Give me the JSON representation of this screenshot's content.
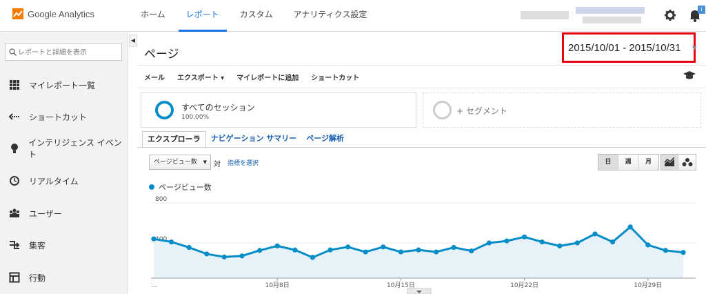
{
  "app": {
    "name": "Google Analytics"
  },
  "nav": {
    "items": [
      "ホーム",
      "レポート",
      "カスタム",
      "アナリティクス設定"
    ],
    "active": 1
  },
  "header": {
    "notification_badge": "i"
  },
  "sidebar": {
    "search_placeholder": "レポートと詳細を表示",
    "items": [
      {
        "label": "マイレポート一覧",
        "icon": "grid-icon"
      },
      {
        "label": "ショートカット",
        "icon": "shortcut-icon"
      },
      {
        "label": "インテリジェンス イベント",
        "icon": "lightbulb-icon"
      },
      {
        "label": "リアルタイム",
        "icon": "clock-icon"
      },
      {
        "label": "ユーザー",
        "icon": "users-icon"
      },
      {
        "label": "集客",
        "icon": "acquisition-icon"
      },
      {
        "label": "行動",
        "icon": "behavior-icon"
      }
    ],
    "collapse_glyph": "◀"
  },
  "page": {
    "title": "ページ",
    "date_range": "2015/10/01 - 2015/10/31"
  },
  "toolbar": {
    "mail": "メール",
    "export": "エクスポート ▾",
    "add_dashboard": "マイレポートに追加",
    "shortcut": "ショートカット"
  },
  "segments": {
    "all_sessions": "すべてのセッション",
    "all_sessions_pct": "100.00%",
    "add_segment": "+ セグメント"
  },
  "tabs": [
    "エクスプローラ",
    "ナビゲーション サマリー",
    "ページ解析"
  ],
  "controls": {
    "metric": "ページビュー数",
    "vs": "対",
    "choose_metric": "指標を選択",
    "period": [
      "日",
      "週",
      "月"
    ]
  },
  "colors": {
    "accent": "#058dc7",
    "fill": "#e6f2f8",
    "highlight": "#e60012"
  },
  "chart_data": {
    "type": "area",
    "series": [
      {
        "name": "ページビュー数",
        "values": [
          440,
          410,
          355,
          290,
          260,
          270,
          325,
          370,
          330,
          255,
          330,
          360,
          310,
          360,
          310,
          330,
          310,
          355,
          320,
          400,
          420,
          460,
          410,
          370,
          400,
          490,
          410,
          560,
          380,
          325,
          305
        ]
      }
    ],
    "x": [
      "...",
      "10月2日",
      "10月3日",
      "10月4日",
      "10月5日",
      "10月6日",
      "10月7日",
      "10月8日",
      "10月9日",
      "10月10日",
      "10月11日",
      "10月12日",
      "10月13日",
      "10月14日",
      "10月15日",
      "10月16日",
      "10月17日",
      "10月18日",
      "10月19日",
      "10月20日",
      "10月21日",
      "10月22日",
      "10月23日",
      "10月24日",
      "10月25日",
      "10月26日",
      "10月27日",
      "10月28日",
      "10月29日",
      "10月30日",
      "10月31日"
    ],
    "tick_labels": [
      {
        "index": 0,
        "label": "..."
      },
      {
        "index": 7,
        "label": "10月8日"
      },
      {
        "index": 14,
        "label": "10月15日"
      },
      {
        "index": 21,
        "label": "10月22日"
      },
      {
        "index": 28,
        "label": "10月29日"
      }
    ],
    "y_ticks": [
      800,
      400
    ],
    "ylim": [
      0,
      800
    ],
    "grid": true
  }
}
